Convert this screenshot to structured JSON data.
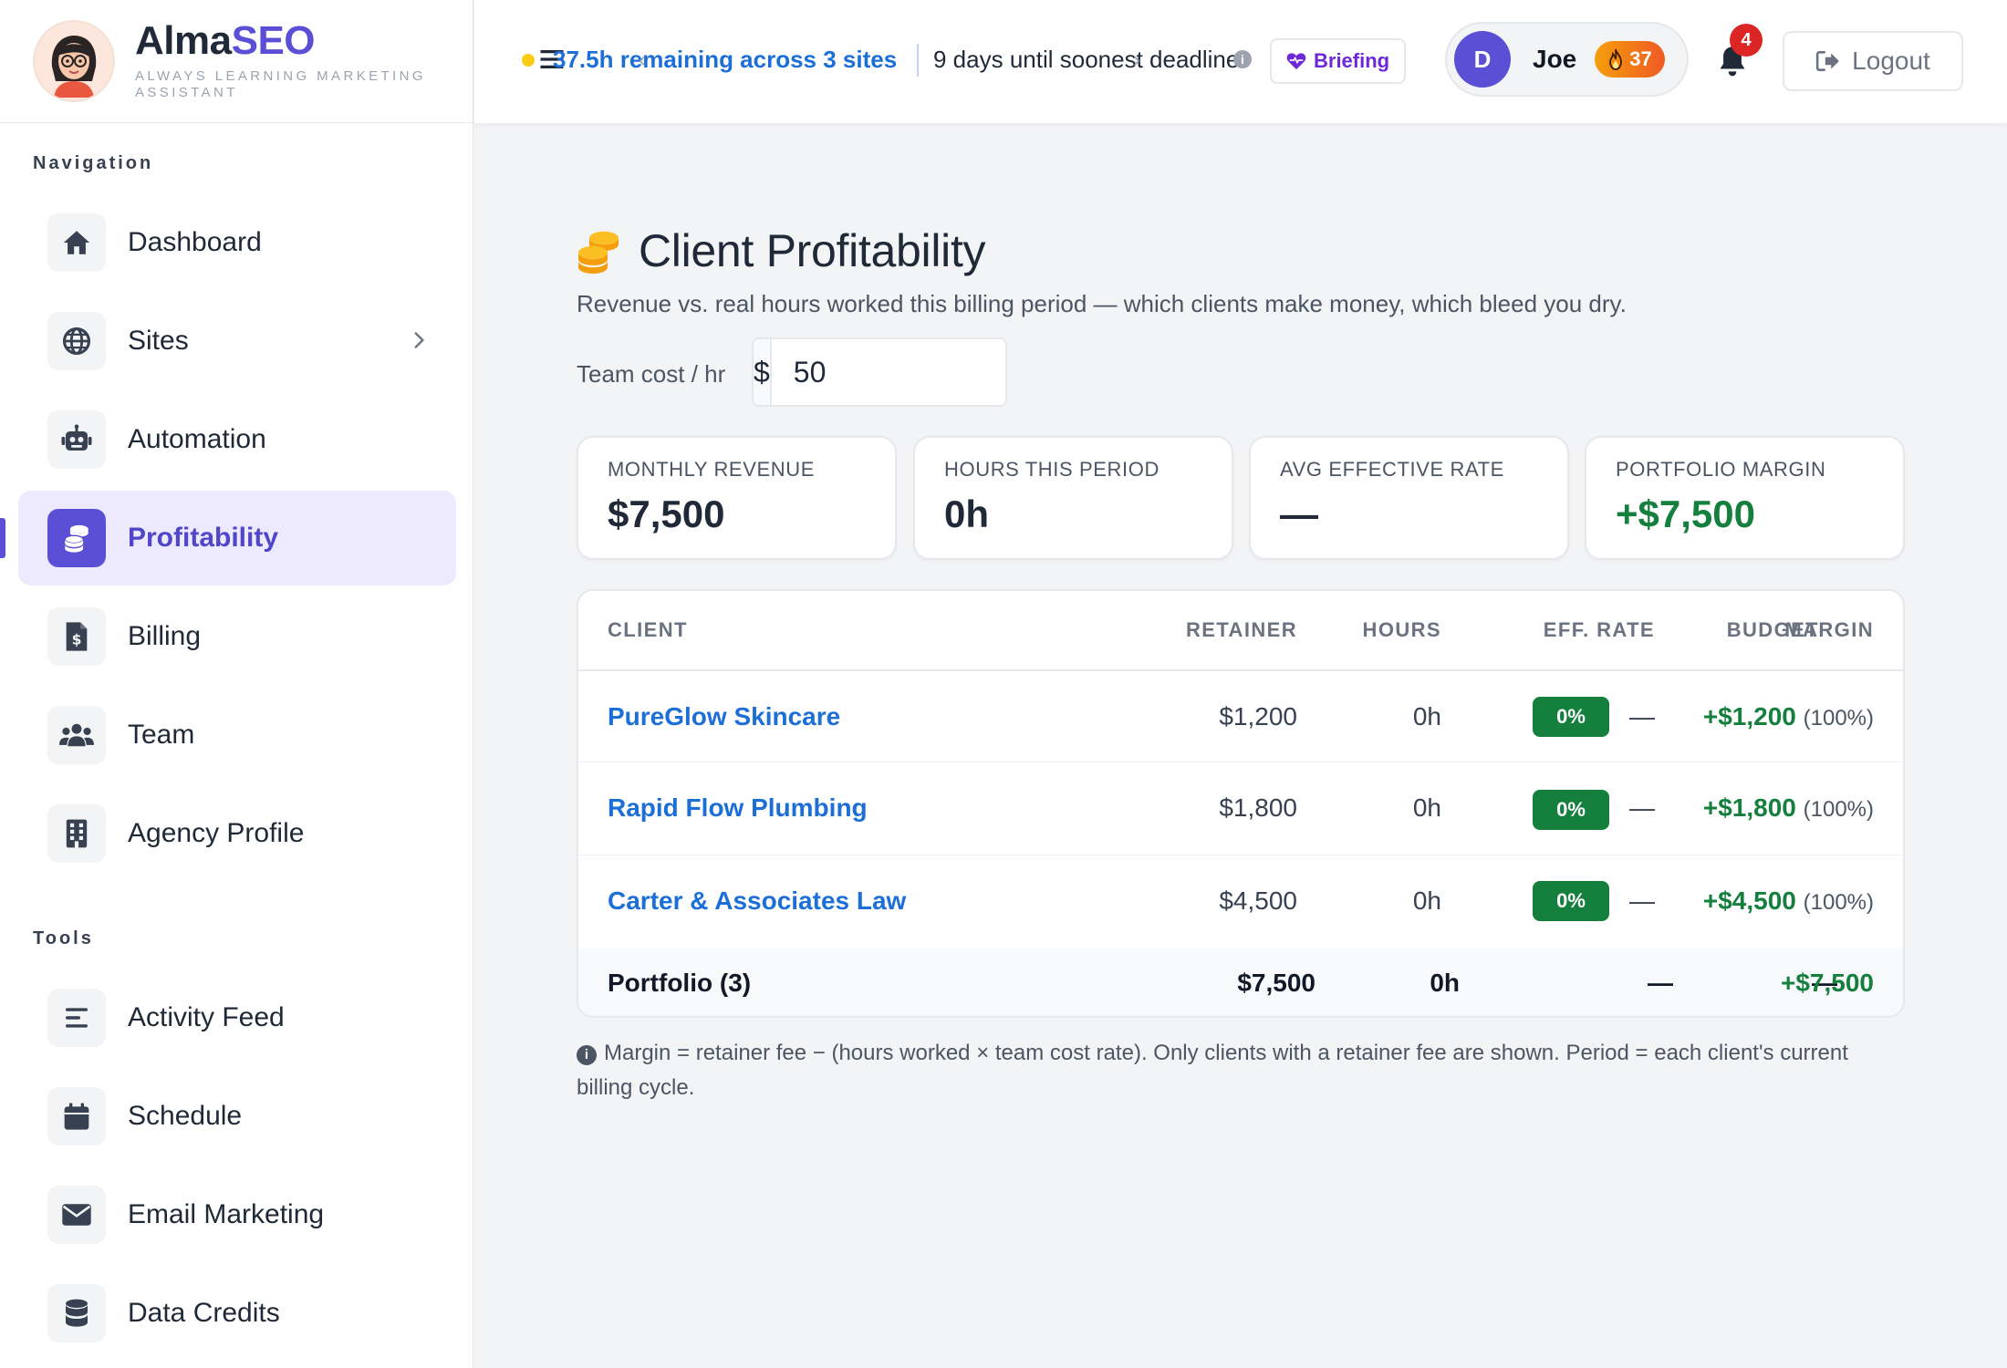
{
  "brand": {
    "name_part1": "Alma",
    "name_part2": "SEO",
    "tagline": "Always Learning Marketing Assistant"
  },
  "sidebar": {
    "nav_title": "Navigation",
    "nav_items": [
      {
        "label": "Dashboard",
        "icon": "home-icon"
      },
      {
        "label": "Sites",
        "icon": "globe-icon",
        "has_chevron": true
      },
      {
        "label": "Automation",
        "icon": "robot-icon"
      },
      {
        "label": "Profitability",
        "icon": "coins-icon",
        "active": true
      },
      {
        "label": "Billing",
        "icon": "invoice-icon"
      },
      {
        "label": "Team",
        "icon": "users-icon"
      },
      {
        "label": "Agency Profile",
        "icon": "building-icon"
      }
    ],
    "tools_title": "Tools",
    "tool_items": [
      {
        "label": "Activity Feed",
        "icon": "list-icon"
      },
      {
        "label": "Schedule",
        "icon": "calendar-icon"
      },
      {
        "label": "Email Marketing",
        "icon": "envelope-icon"
      },
      {
        "label": "Data Credits",
        "icon": "database-icon"
      }
    ]
  },
  "topbar": {
    "ticker_main": "37.5h remaining across 3 sites",
    "ticker_second": "9 days until soonest deadline",
    "briefing_label": "Briefing",
    "user_initial": "D",
    "user_name": "Joe",
    "streak": "37",
    "notification_count": "4",
    "logout_label": "Logout"
  },
  "page": {
    "title": "Client Profitability",
    "subtitle": "Revenue vs. real hours worked this billing period — which clients make money, which bleed you dry.",
    "cost_label": "Team cost / hr",
    "cost_prefix": "$",
    "cost_value": "50"
  },
  "stats": [
    {
      "label": "Monthly Revenue",
      "value": "$7,500"
    },
    {
      "label": "Hours This Period",
      "value": "0h"
    },
    {
      "label": "Avg Effective Rate",
      "value": "—"
    },
    {
      "label": "Portfolio Margin",
      "value": "+$7,500"
    }
  ],
  "table": {
    "headers": {
      "client": "CLIENT",
      "retainer": "RETAINER",
      "hours": "HOURS",
      "eff_rate": "EFF. RATE",
      "budget": "BUDGET",
      "margin": "MARGIN"
    },
    "rows": [
      {
        "client": "PureGlow Skincare",
        "retainer": "$1,200",
        "hours": "0h",
        "eff_rate": "—",
        "budget": "0%",
        "margin": "+$1,200",
        "margin_pct": "(100%)"
      },
      {
        "client": "Rapid Flow Plumbing",
        "retainer": "$1,800",
        "hours": "0h",
        "eff_rate": "—",
        "budget": "0%",
        "margin": "+$1,800",
        "margin_pct": "(100%)"
      },
      {
        "client": "Carter & Associates Law",
        "retainer": "$4,500",
        "hours": "0h",
        "eff_rate": "—",
        "budget": "0%",
        "margin": "+$4,500",
        "margin_pct": "(100%)"
      }
    ],
    "footer": {
      "label": "Portfolio (3)",
      "retainer": "$7,500",
      "hours": "0h",
      "eff_rate": "—",
      "budget": "—",
      "margin": "+$7,500"
    }
  },
  "footnote": "Margin = retainer fee − (hours worked × team cost rate). Only clients with a retainer fee are shown. Period = each client's current billing cycle.",
  "colors": {
    "brand": "#5b4fd6",
    "link": "#1d6fd8",
    "positive": "#15803d",
    "alert": "#dc2626"
  }
}
